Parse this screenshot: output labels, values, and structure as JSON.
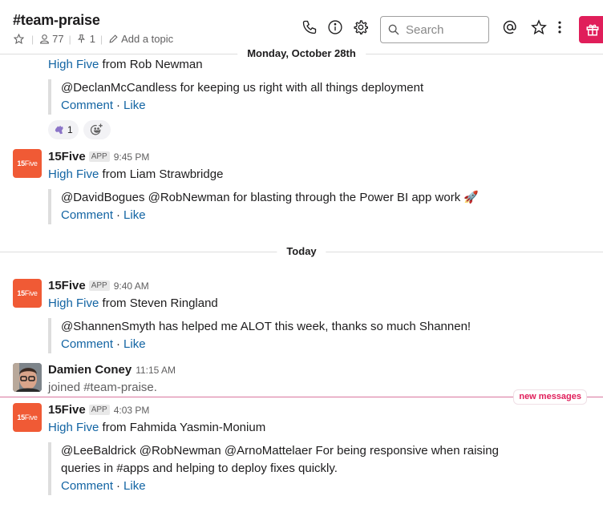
{
  "header": {
    "channel_name": "#team-praise",
    "member_count": "77",
    "pinned_count": "1",
    "add_topic": "Add a topic",
    "search_placeholder": "Search",
    "icons": [
      "star-icon",
      "member-icon",
      "pin-icon",
      "pencil-icon",
      "phone-icon",
      "info-icon",
      "gear-icon",
      "search-icon",
      "at-icon",
      "star-icon",
      "more-vertical-icon",
      "gift-icon"
    ]
  },
  "dividers": {
    "monday": "Monday, October 28th",
    "today": "Today",
    "new_messages": "new messages"
  },
  "common": {
    "high_five": "High Five",
    "comment": "Comment",
    "like": "Like",
    "dot": "·",
    "app_badge": "APP",
    "app_name": "15Five",
    "avatar_bold": "15",
    "avatar_light": "Five"
  },
  "messages": [
    {
      "from_text": " from Rob Newman",
      "body": "@DeclanMcCandless for keeping us right with all things deployment",
      "reactions": [
        {
          "emoji": "high-five",
          "count": "1"
        }
      ]
    },
    {
      "sender": "15Five",
      "time": "9:45 PM",
      "from_text": " from Liam Strawbridge",
      "body": "@DavidBogues @RobNewman for blasting through the Power BI app work",
      "emoji": "🚀"
    },
    {
      "sender": "15Five",
      "time": "9:40 AM",
      "from_text": " from Steven Ringland",
      "body": "@ShannenSmyth has helped me ALOT this week, thanks so much Shannen!"
    },
    {
      "sender": "Damien Coney",
      "time": "11:15 AM",
      "text": "joined #team-praise."
    },
    {
      "sender": "15Five",
      "time": "4:03 PM",
      "from_text": " from Fahmida Yasmin-Monium",
      "body_line1": "@LeeBaldrick @RobNewman @ArnoMattelaer For being responsive when raising",
      "body_line2": "queries in #apps and helping to deploy fixes quickly."
    }
  ]
}
